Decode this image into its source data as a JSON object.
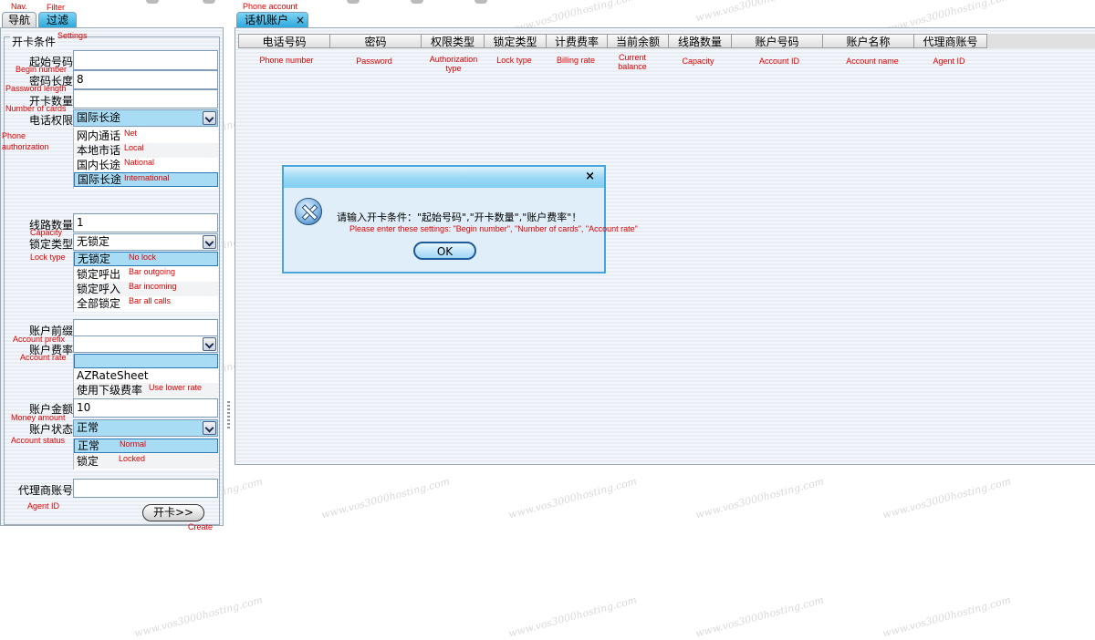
{
  "top_annotations": {
    "nav": "Nav.",
    "filter": "Filter",
    "settings": "Settings",
    "phone_account": "Phone account"
  },
  "left_tabs": [
    {
      "label": "导航"
    },
    {
      "label": "过滤"
    }
  ],
  "right_tab": {
    "label": "话机账户",
    "close": "×"
  },
  "form": {
    "group_title": "开卡条件",
    "begin_number": {
      "label": "起始号码",
      "en": "Begin number",
      "value": ""
    },
    "password_length": {
      "label": "密码长度",
      "en": "Password length",
      "value": "8"
    },
    "number_of_cards": {
      "label": "开卡数量",
      "en": "Number of cards",
      "value": ""
    },
    "phone_authorization": {
      "label": "电话权限",
      "en": "Phone authorization",
      "selected": "国际长途",
      "options": [
        {
          "label": "网内通话",
          "en": "Net"
        },
        {
          "label": "本地市话",
          "en": "Local"
        },
        {
          "label": "国内长途",
          "en": "National"
        },
        {
          "label": "国际长途",
          "en": "International"
        }
      ]
    },
    "capacity": {
      "label": "线路数量",
      "en": "Capacity",
      "value": "1"
    },
    "lock_type": {
      "label": "锁定类型",
      "en": "Lock type",
      "selected": "无锁定",
      "options": [
        {
          "label": "无锁定",
          "en": "No lock"
        },
        {
          "label": "锁定呼出",
          "en": "Bar outgoing"
        },
        {
          "label": "锁定呼入",
          "en": "Bar incoming"
        },
        {
          "label": "全部锁定",
          "en": "Bar all calls"
        }
      ]
    },
    "account_prefix": {
      "label": "账户前缀",
      "en": "Account prefix",
      "value": ""
    },
    "account_rate": {
      "label": "账户费率",
      "en": "Account rate",
      "selected": "",
      "options": [
        {
          "label": "",
          "en": ""
        },
        {
          "label": "AZRateSheet",
          "en": ""
        },
        {
          "label": "使用下级费率",
          "en": "Use lower rate"
        }
      ]
    },
    "money_amount": {
      "label": "账户金额",
      "en": "Money amount",
      "value": "10"
    },
    "account_status": {
      "label": "账户状态",
      "en": "Account status",
      "selected": "正常",
      "options": [
        {
          "label": "正常",
          "en": "Normal"
        },
        {
          "label": "锁定",
          "en": "Locked"
        }
      ]
    },
    "agent_id": {
      "label": "代理商账号",
      "en": "Agent ID",
      "value": ""
    },
    "create_button": {
      "label": "开卡>>",
      "en": "Create"
    }
  },
  "table": {
    "columns": [
      {
        "label": "电话号码",
        "en": "Phone number"
      },
      {
        "label": "密码",
        "en": "Password"
      },
      {
        "label": "权限类型",
        "en": "Authorization type"
      },
      {
        "label": "锁定类型",
        "en": "Lock type"
      },
      {
        "label": "计费费率",
        "en": "Billing rate"
      },
      {
        "label": "当前余额",
        "en": "Current balance"
      },
      {
        "label": "线路数量",
        "en": "Capacity"
      },
      {
        "label": "账户号码",
        "en": "Account ID"
      },
      {
        "label": "账户名称",
        "en": "Account name"
      },
      {
        "label": "代理商账号",
        "en": "Agent ID"
      }
    ],
    "rows": []
  },
  "dialog": {
    "close": "×",
    "icon": "error-icon",
    "message": "请输入开卡条件：\"起始号码\",\"开卡数量\",\"账户费率\"！",
    "message_en": "Please enter these settings: \"Begin number\", \"Number of cards\", \"Account rate\"",
    "ok_label": "OK"
  },
  "watermark": "www.vos3000hosting.com"
}
